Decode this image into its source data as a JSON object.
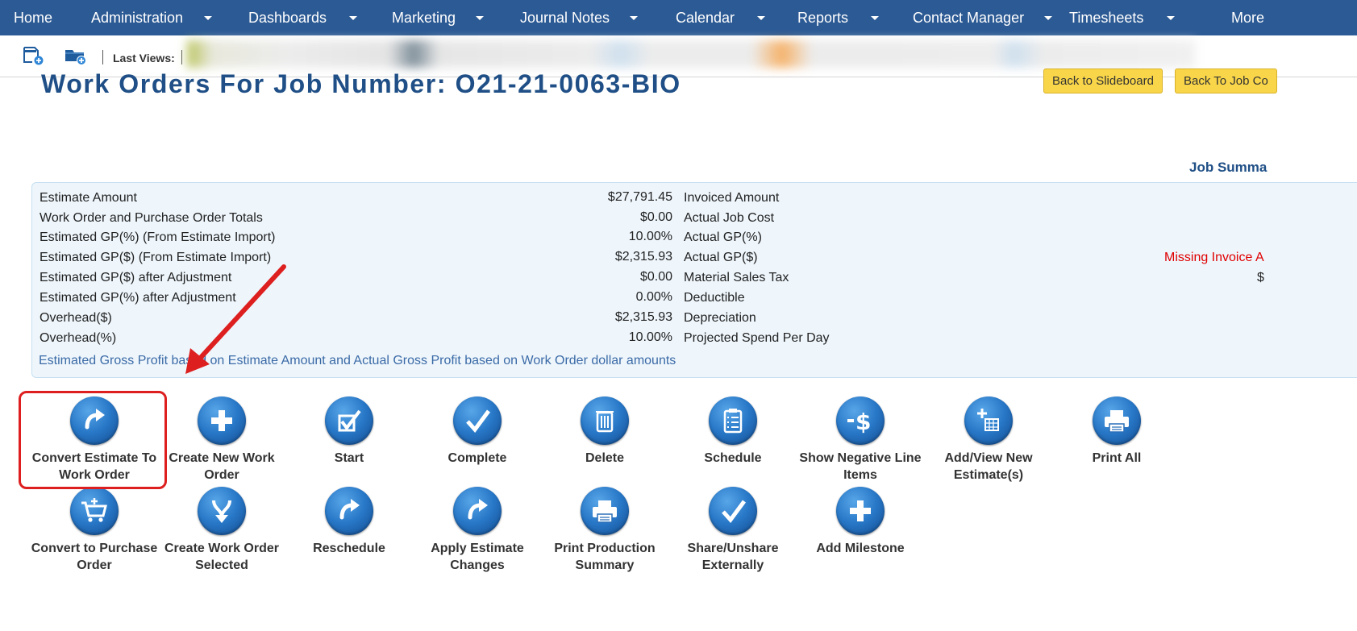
{
  "nav": {
    "items": [
      {
        "label": "Home",
        "caret": false
      },
      {
        "label": "Administration",
        "caret": true
      },
      {
        "label": "Dashboards",
        "caret": true
      },
      {
        "label": "Marketing",
        "caret": true
      },
      {
        "label": "Journal Notes",
        "caret": true
      },
      {
        "label": "Calendar",
        "caret": true
      },
      {
        "label": "Reports",
        "caret": true
      },
      {
        "label": "Contact Manager",
        "caret": true
      },
      {
        "label": "Timesheets",
        "caret": true
      },
      {
        "label": "More",
        "caret": false
      }
    ]
  },
  "toolbar": {
    "last_views_label": "Last Views:",
    "new_file_icon": "new-document-icon",
    "new_folder_icon": "new-folder-icon"
  },
  "header": {
    "title": "Work Orders For Job Number: O21-21-0063-BIO",
    "back_slideboard": "Back to Slideboard",
    "back_job": "Back To Job Co"
  },
  "job_summary": {
    "title": "Job Summa",
    "left_rows": [
      {
        "label": "Estimate Amount",
        "value": "$27,791.45"
      },
      {
        "label": "Work Order and Purchase Order Totals",
        "value": "$0.00"
      },
      {
        "label": "Estimated GP(%) (From Estimate Import)",
        "value": "10.00%"
      },
      {
        "label": "Estimated GP($) (From Estimate Import)",
        "value": "$2,315.93"
      },
      {
        "label": "Estimated GP($) after Adjustment",
        "value": "$0.00"
      },
      {
        "label": "Estimated GP(%) after Adjustment",
        "value": "0.00%"
      },
      {
        "label": "Overhead($)",
        "value": "$2,315.93"
      },
      {
        "label": "Overhead(%)",
        "value": "10.00%"
      }
    ],
    "right_rows": [
      {
        "label": "Invoiced Amount"
      },
      {
        "label": "Actual Job Cost"
      },
      {
        "label": "Actual GP(%)"
      },
      {
        "label": "Actual GP($)"
      },
      {
        "label": "Material Sales Tax"
      },
      {
        "label": "Deductible"
      },
      {
        "label": "Depreciation"
      },
      {
        "label": "Projected Spend Per Day"
      }
    ],
    "missing_invoice": "Missing Invoice A",
    "sales_tax_partial": "$",
    "note": "Estimated Gross Profit based on Estimate Amount and Actual Gross Profit based on Work Order dollar amounts"
  },
  "actions": {
    "row1": [
      {
        "label": "Convert Estimate To Work Order",
        "icon": "redo-arrow-icon"
      },
      {
        "label": "Create New Work Order",
        "icon": "plus-icon"
      },
      {
        "label": "Start",
        "icon": "checkbox-icon"
      },
      {
        "label": "Complete",
        "icon": "checkmark-icon"
      },
      {
        "label": "Delete",
        "icon": "trash-icon"
      },
      {
        "label": "Schedule",
        "icon": "clipboard-icon"
      },
      {
        "label": "Show Negative Line Items",
        "icon": "negative-dollar-icon"
      },
      {
        "label": "Add/View New Estimate(s)",
        "icon": "add-estimate-icon"
      },
      {
        "label": "Print All",
        "icon": "printer-icon"
      }
    ],
    "row2": [
      {
        "label": "Convert to Purchase Order",
        "icon": "cart-icon"
      },
      {
        "label": "Create Work Order Selected",
        "icon": "merge-arrow-icon"
      },
      {
        "label": "Reschedule",
        "icon": "redo-arrow-icon"
      },
      {
        "label": "Apply Estimate Changes",
        "icon": "redo-arrow-icon"
      },
      {
        "label": "Print Production Summary",
        "icon": "printer-icon"
      },
      {
        "label": "Share/Unshare Externally",
        "icon": "checkmark-icon"
      },
      {
        "label": "Add Milestone",
        "icon": "plus-icon"
      }
    ]
  },
  "annotation": {
    "highlight_color": "#dd1f1f"
  }
}
